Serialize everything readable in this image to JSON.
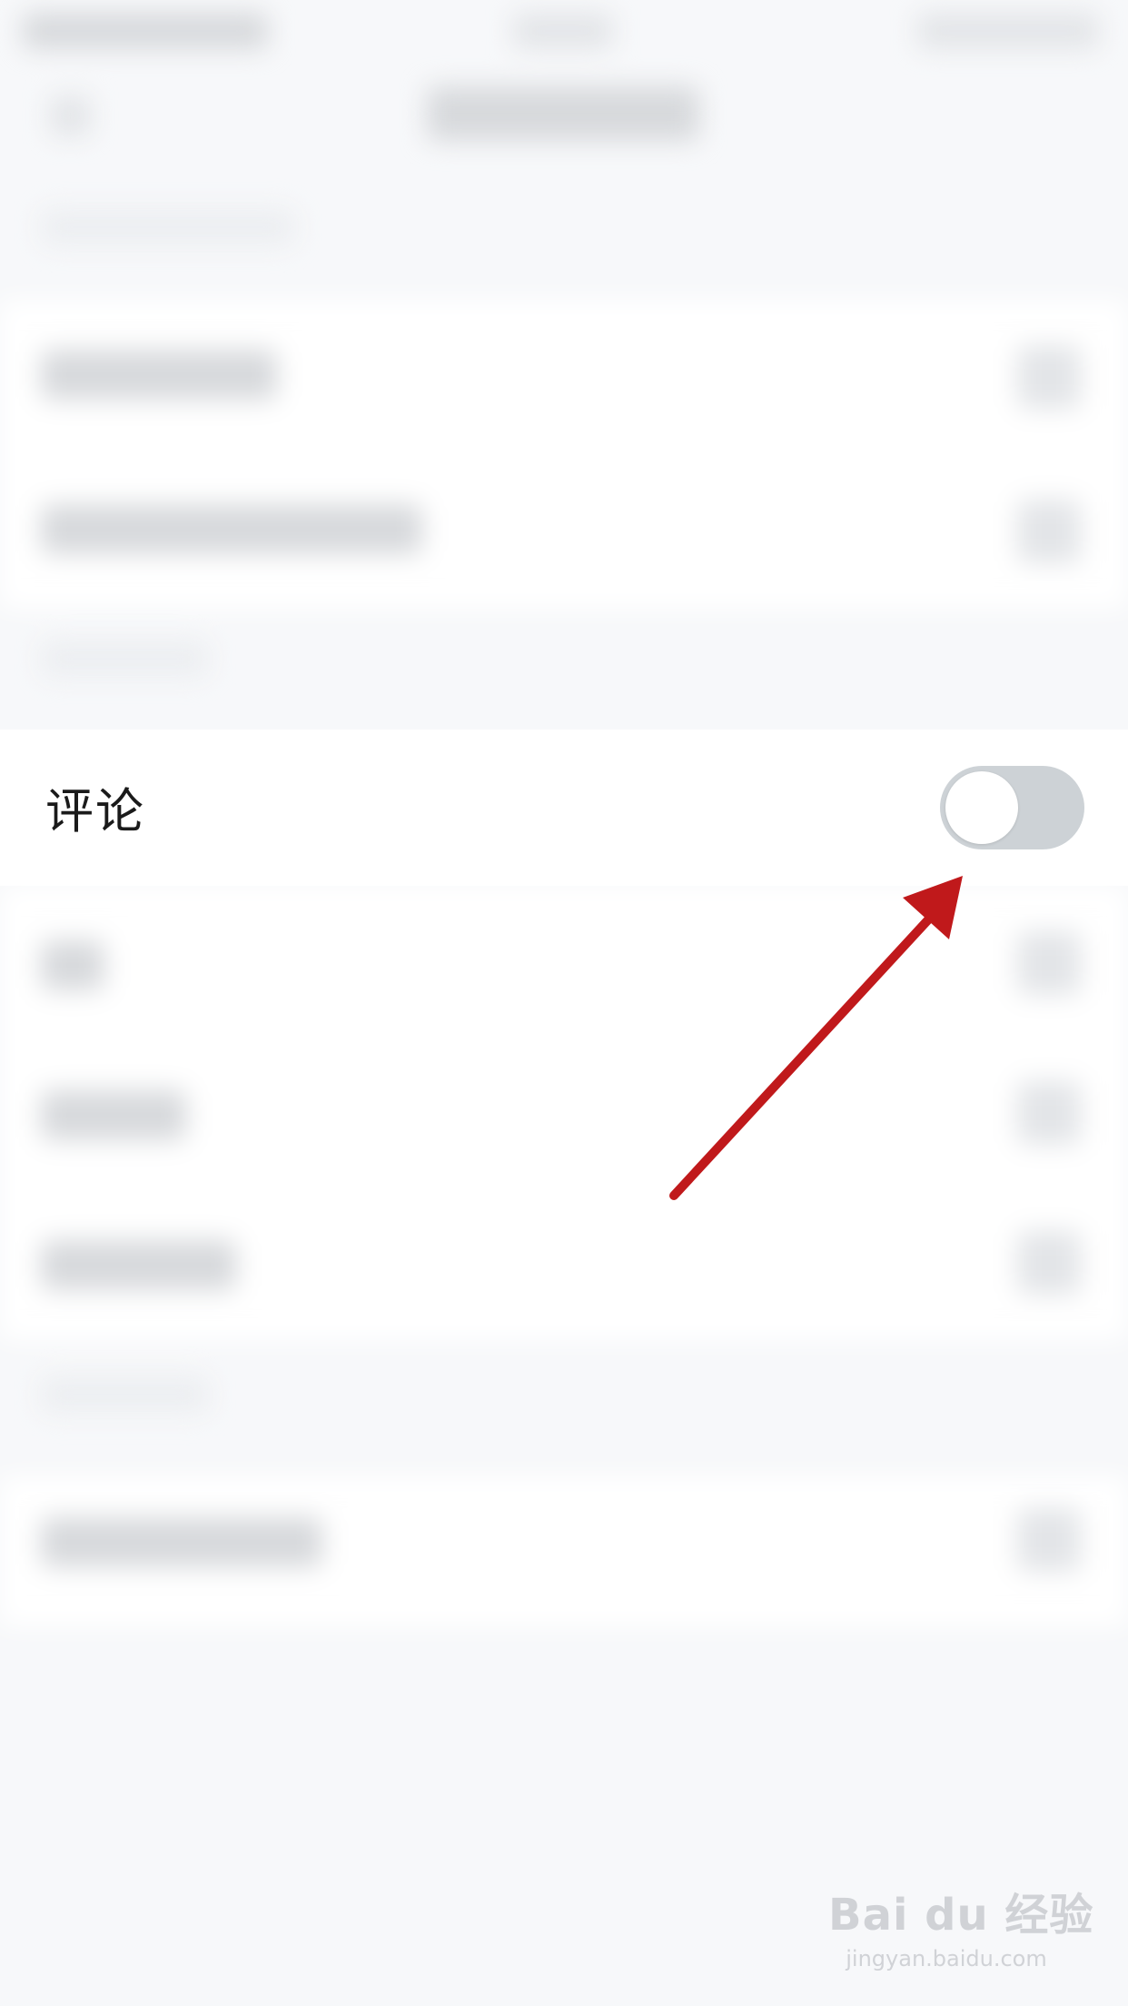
{
  "setting_row": {
    "label": "评论",
    "toggle": {
      "state": "off"
    }
  },
  "annotation": {
    "type": "red-arrow",
    "color": "#c0191b",
    "points_to": "comment-toggle"
  },
  "watermark": {
    "brand": "Bai du 经验",
    "url": "jingyan.baidu.com"
  },
  "colors": {
    "page_background": "#f7f8fa",
    "row_background": "#ffffff",
    "label_text": "#1a1a1a",
    "toggle_off_track": "#cdd2d6",
    "toggle_knob": "#ffffff",
    "arrow": "#c0191b"
  }
}
